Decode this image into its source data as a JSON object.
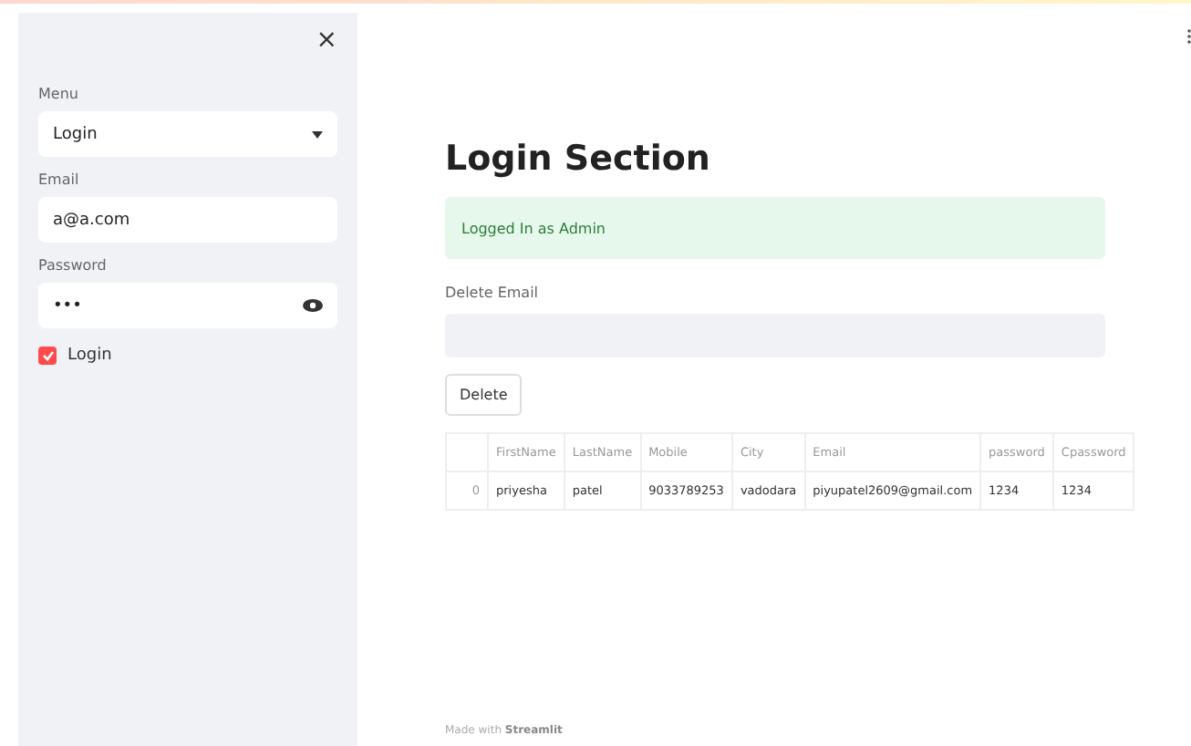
{
  "sidebar": {
    "close": "×",
    "menu": {
      "label": "Menu",
      "value": "Login"
    },
    "email": {
      "label": "Email",
      "value": "a@a.com"
    },
    "password": {
      "label": "Password",
      "value": "•••"
    },
    "login_checkbox": {
      "label": "Login",
      "checked": true
    }
  },
  "main": {
    "title": "Login Section",
    "alert": "Logged In as Admin",
    "delete_email": {
      "label": "Delete Email"
    },
    "delete_button": "Delete",
    "table": {
      "columns": [
        "",
        "FirstName",
        "LastName",
        "Mobile",
        "City",
        "Email",
        "password",
        "Cpassword"
      ],
      "rows": [
        [
          "0",
          "priyesha",
          "patel",
          "9033789253",
          "vadodara",
          "piyupatel2609@gmail.com",
          "1234",
          "1234"
        ]
      ]
    },
    "footer": "Made with **Streamlit**"
  }
}
